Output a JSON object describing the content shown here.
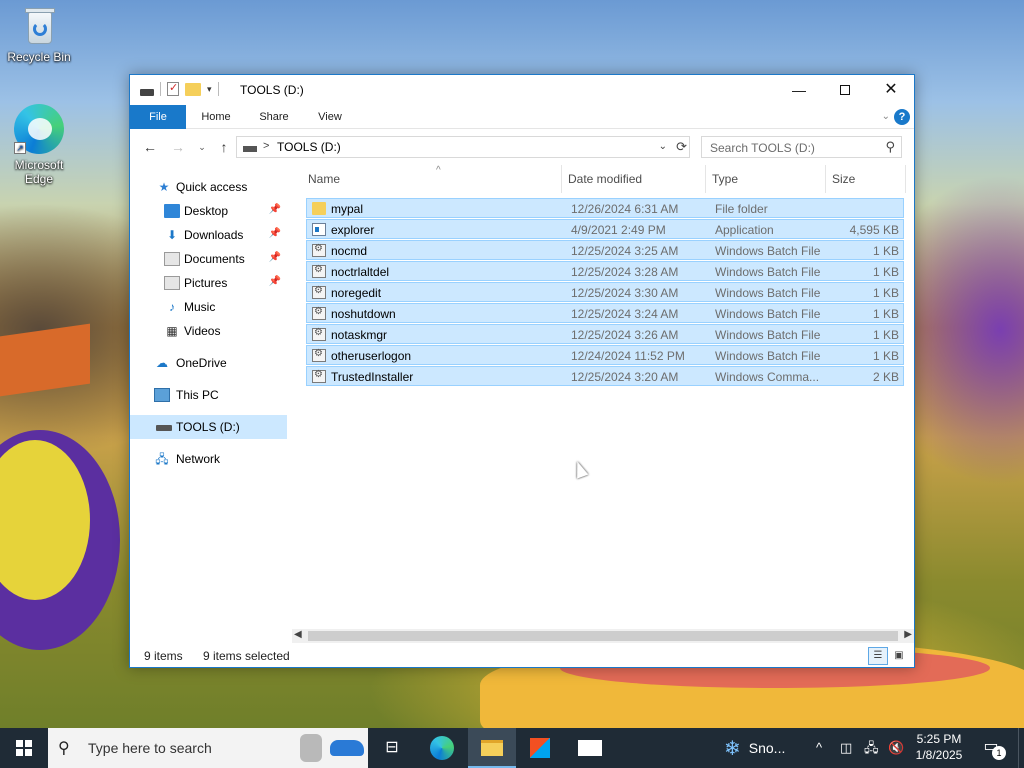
{
  "desktop": {
    "icons": [
      {
        "label": "Recycle Bin",
        "icon": "recycle-bin-icon"
      },
      {
        "label": "Microsoft Edge",
        "icon": "edge-icon"
      }
    ]
  },
  "window": {
    "title": "TOOLS (D:)",
    "controls": {
      "minimize": "—",
      "close": "✕"
    },
    "ribbon_tabs": [
      "File",
      "Home",
      "Share",
      "View"
    ],
    "help": "?",
    "address": {
      "path": "TOOLS (D:)",
      "separator": ">"
    },
    "search": {
      "placeholder": "Search TOOLS (D:)"
    },
    "nav_pane": [
      {
        "label": "Quick access",
        "icon": "star-icon"
      },
      {
        "label": "Desktop",
        "icon": "desktop-folder-icon",
        "pinned": true
      },
      {
        "label": "Downloads",
        "icon": "downloads-icon",
        "pinned": true
      },
      {
        "label": "Documents",
        "icon": "documents-icon",
        "pinned": true
      },
      {
        "label": "Pictures",
        "icon": "pictures-icon",
        "pinned": true
      },
      {
        "label": "Music",
        "icon": "music-icon"
      },
      {
        "label": "Videos",
        "icon": "videos-icon"
      },
      {
        "label": "OneDrive",
        "icon": "onedrive-icon"
      },
      {
        "label": "This PC",
        "icon": "this-pc-icon"
      },
      {
        "label": "TOOLS (D:)",
        "icon": "drive-icon",
        "selected": true
      },
      {
        "label": "Network",
        "icon": "network-icon"
      }
    ],
    "columns": {
      "name": "Name",
      "date": "Date modified",
      "type": "Type",
      "size": "Size"
    },
    "files": [
      {
        "name": "mypal",
        "date": "12/26/2024 6:31 AM",
        "type": "File folder",
        "size": "",
        "icon": "folder"
      },
      {
        "name": "explorer",
        "date": "4/9/2021 2:49 PM",
        "type": "Application",
        "size": "4,595 KB",
        "icon": "app"
      },
      {
        "name": "nocmd",
        "date": "12/25/2024 3:25 AM",
        "type": "Windows Batch File",
        "size": "1 KB",
        "icon": "bat"
      },
      {
        "name": "noctrlaltdel",
        "date": "12/25/2024 3:28 AM",
        "type": "Windows Batch File",
        "size": "1 KB",
        "icon": "bat"
      },
      {
        "name": "noregedit",
        "date": "12/25/2024 3:30 AM",
        "type": "Windows Batch File",
        "size": "1 KB",
        "icon": "bat"
      },
      {
        "name": "noshutdown",
        "date": "12/25/2024 3:24 AM",
        "type": "Windows Batch File",
        "size": "1 KB",
        "icon": "bat"
      },
      {
        "name": "notaskmgr",
        "date": "12/25/2024 3:26 AM",
        "type": "Windows Batch File",
        "size": "1 KB",
        "icon": "bat"
      },
      {
        "name": "otheruserlogon",
        "date": "12/24/2024 11:52 PM",
        "type": "Windows Batch File",
        "size": "1 KB",
        "icon": "bat"
      },
      {
        "name": "TrustedInstaller",
        "date": "12/25/2024 3:20 AM",
        "type": "Windows Comma...",
        "size": "2 KB",
        "icon": "bat"
      }
    ],
    "status": {
      "count": "9 items",
      "selected": "9 items selected"
    }
  },
  "taskbar": {
    "search_placeholder": "Type here to search",
    "weather": "Sno...",
    "time": "5:25 PM",
    "date": "1/8/2025",
    "notification_count": "1"
  },
  "colors": {
    "accent": "#1979ca",
    "selection": "#cce8ff",
    "taskbar": "#1f2b36"
  }
}
